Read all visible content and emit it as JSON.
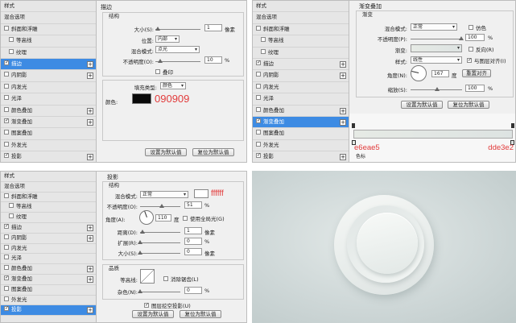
{
  "sidebar": {
    "header": "样式",
    "items": [
      {
        "label": "混合选项",
        "sub": false,
        "check": false,
        "plus": false
      },
      {
        "label": "斜面和浮雕",
        "sub": false,
        "check": true,
        "checked": false,
        "plus": false
      },
      {
        "label": "等高线",
        "sub": true,
        "check": true,
        "checked": false,
        "plus": false
      },
      {
        "label": "纹理",
        "sub": true,
        "check": true,
        "checked": false,
        "plus": false
      },
      {
        "label": "描边",
        "sub": false,
        "check": true,
        "checked": true,
        "plus": true
      },
      {
        "label": "内阴影",
        "sub": false,
        "check": true,
        "checked": false,
        "plus": true
      },
      {
        "label": "内发光",
        "sub": false,
        "check": true,
        "checked": false,
        "plus": false
      },
      {
        "label": "光泽",
        "sub": false,
        "check": true,
        "checked": false,
        "plus": false
      },
      {
        "label": "颜色叠加",
        "sub": false,
        "check": true,
        "checked": false,
        "plus": true
      },
      {
        "label": "渐变叠加",
        "sub": false,
        "check": true,
        "checked": true,
        "plus": true
      },
      {
        "label": "图案叠加",
        "sub": false,
        "check": true,
        "checked": false,
        "plus": false
      },
      {
        "label": "外发光",
        "sub": false,
        "check": true,
        "checked": false,
        "plus": false
      },
      {
        "label": "投影",
        "sub": false,
        "check": true,
        "checked": true,
        "plus": true
      }
    ]
  },
  "stroke": {
    "section": "描边",
    "group": "结构",
    "size_label": "大小(S):",
    "size_value": "1",
    "size_unit": "像素",
    "position_label": "位置:",
    "position_value": "内部",
    "blend_label": "混合模式:",
    "blend_value": "点光",
    "opacity_label": "不透明度(O):",
    "opacity_value": "10",
    "opacity_unit": "%",
    "overprint_label": "叠印",
    "fill_type_label": "填充类型:",
    "fill_type_value": "颜色",
    "color_label": "颜色:",
    "color_hex": "#090909",
    "color_annot": "090909",
    "btn_default": "设置为默认值",
    "btn_reset": "复位为默认值"
  },
  "gradient": {
    "section": "渐变叠加",
    "group": "渐变",
    "blend_label": "混合模式:",
    "blend_value": "正常",
    "dither_label": "仿色",
    "opacity_label": "不透明度(P):",
    "opacity_value": "100",
    "opacity_unit": "%",
    "gradient_label": "渐变:",
    "reverse_label": "反向(R)",
    "style_label": "样式:",
    "style_value": "线性",
    "align_label": "与图层对齐(I)",
    "angle_label": "角度(N):",
    "angle_value": "167",
    "angle_unit": "度",
    "reset_align": "重置对齐",
    "scale_label": "缩放(S):",
    "scale_value": "100",
    "scale_unit": "%",
    "btn_default": "设置为默认值",
    "btn_reset": "复位为默认值",
    "stop_left_annot": "e6eae5",
    "stop_right_annot": "dde3e2",
    "stop_left_hex": "#e6eae5",
    "stop_right_hex": "#dde3e2",
    "color_label": "色标"
  },
  "shadow": {
    "section": "投影",
    "group": "结构",
    "blend_label": "混合模式:",
    "blend_value": "正常",
    "color_annot": "ffffff",
    "opacity_label": "不透明度(O):",
    "opacity_value": "51",
    "opacity_unit": "%",
    "angle_label": "角度(A):",
    "angle_value": "110",
    "angle_unit": "度",
    "global_light_label": "使用全局光(G)",
    "distance_label": "距离(D):",
    "distance_value": "1",
    "distance_unit": "像素",
    "spread_label": "扩展(R):",
    "spread_value": "0",
    "spread_unit": "%",
    "size_label": "大小(S):",
    "size_value": "0",
    "size_unit": "像素",
    "quality_group": "品质",
    "contour_label": "等高线:",
    "antialias_label": "消除锯齿(L)",
    "noise_label": "杂色(N):",
    "noise_value": "0",
    "noise_unit": "%",
    "knockout_label": "图层挖空投影(U)",
    "btn_default": "设置为默认值",
    "btn_reset": "复位为默认值"
  },
  "preview": {
    "background_hex": "#cdd6d6",
    "button_hex": "#eef1ef"
  }
}
